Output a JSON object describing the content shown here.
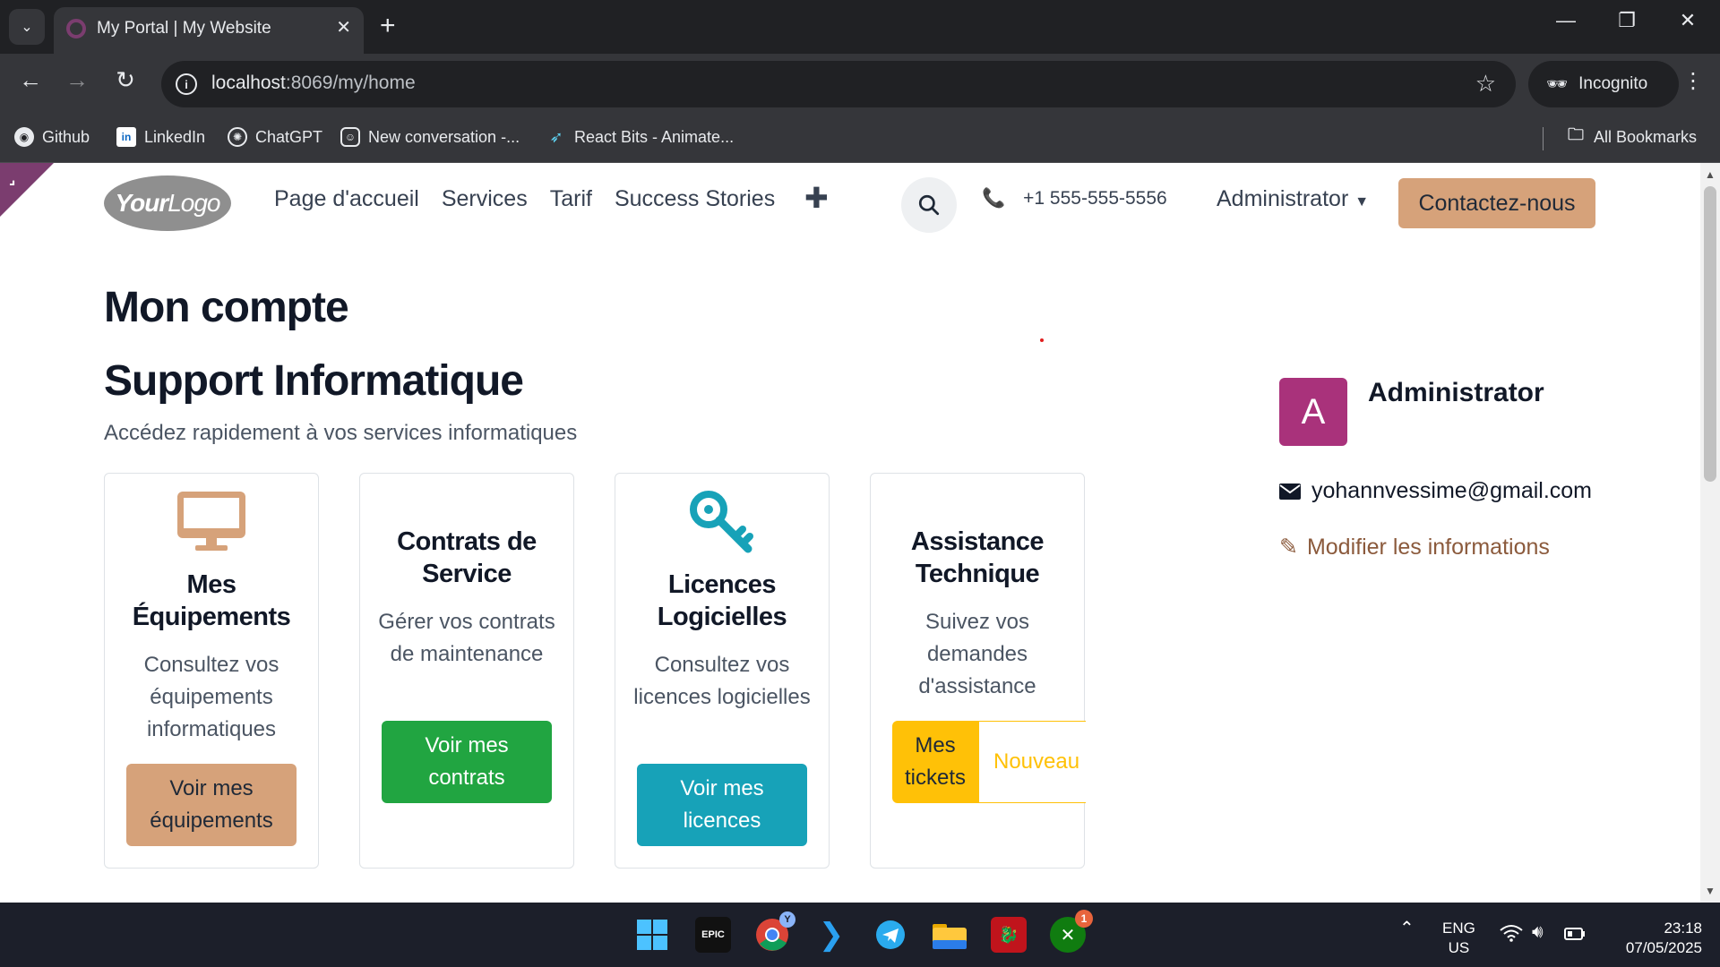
{
  "browser": {
    "tab_title": "My Portal | My Website",
    "tab_close": "✕",
    "new_tab": "+",
    "url_host": "localhost",
    "url_path": ":8069/my/home",
    "incognito_label": "Incognito",
    "bookmarks": [
      {
        "label": "Github",
        "icon": "github-icon"
      },
      {
        "label": "LinkedIn",
        "icon": "linkedin-icon"
      },
      {
        "label": "ChatGPT",
        "icon": "chatgpt-icon"
      },
      {
        "label": "New conversation -...",
        "icon": "discord-icon"
      },
      {
        "label": "React Bits - Animate...",
        "icon": "react-bits-icon"
      }
    ],
    "all_bookmarks": "All Bookmarks"
  },
  "site": {
    "logo_text_bold": "Your",
    "logo_text": "Logo",
    "menu": [
      "Page d'accueil",
      "Services",
      "Tarif",
      "Success Stories"
    ],
    "menu_plus": "✚",
    "phone": "+1 555-555-5556",
    "user_menu": "Administrator",
    "contact_button": "Contactez-nous",
    "brand_color": "#d6a27a"
  },
  "main": {
    "heading": "Mon compte",
    "section_title": "Support Informatique",
    "section_subtitle": "Accédez rapidement à vos services informatiques",
    "cards": [
      {
        "title": "Mes Équipements",
        "desc": "Consultez vos équipements informatiques",
        "button": "Voir mes équipements",
        "icon": "monitor-icon",
        "color": "#d6a27a"
      },
      {
        "title": "Contrats de Service",
        "desc": "Gérer vos contrats de maintenance",
        "button": "Voir mes contrats",
        "color": "#21a541"
      },
      {
        "title": "Licences Logicielles",
        "desc": "Consultez vos licences logicielles",
        "button": "Voir mes licences",
        "icon": "key-icon",
        "color": "#17a2b8"
      },
      {
        "title": "Assistance Technique",
        "desc": "Suivez vos demandes d'assistance",
        "button": "Mes tickets",
        "button2": "Nouveau ticket",
        "color": "#ffc107"
      }
    ]
  },
  "sidebar": {
    "avatar_letter": "A",
    "name": "Administrator",
    "email": "yohannvessime@gmail.com",
    "edit_link": "Modifier les informations"
  },
  "taskbar": {
    "lang": "ENG",
    "region": "US",
    "time": "23:18",
    "date": "07/05/2025",
    "xbox_badge": "1",
    "chrome_badge": "Y"
  }
}
